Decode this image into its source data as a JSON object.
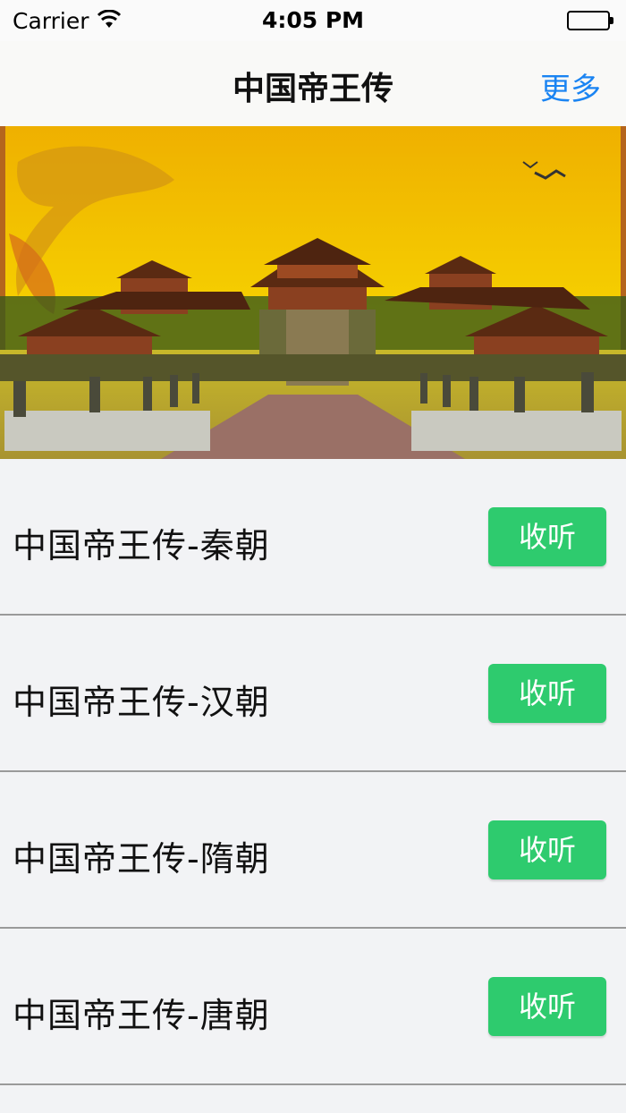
{
  "status_bar": {
    "carrier": "Carrier",
    "time": "4:05 PM"
  },
  "nav": {
    "title": "中国帝王传",
    "more_label": "更多"
  },
  "banner": {
    "icon": "palace-banner-image",
    "colors": {
      "sky": "#f2c300",
      "roof": "#7a3a1a"
    }
  },
  "list": {
    "items": [
      {
        "title": "中国帝王传-秦朝",
        "button": "收听"
      },
      {
        "title": "中国帝王传-汉朝",
        "button": "收听"
      },
      {
        "title": "中国帝王传-隋朝",
        "button": "收听"
      },
      {
        "title": "中国帝王传-唐朝",
        "button": "收听"
      }
    ]
  },
  "colors": {
    "accent": "#1a84f2",
    "button": "#2ecb6e",
    "background": "#f2f3f5"
  }
}
